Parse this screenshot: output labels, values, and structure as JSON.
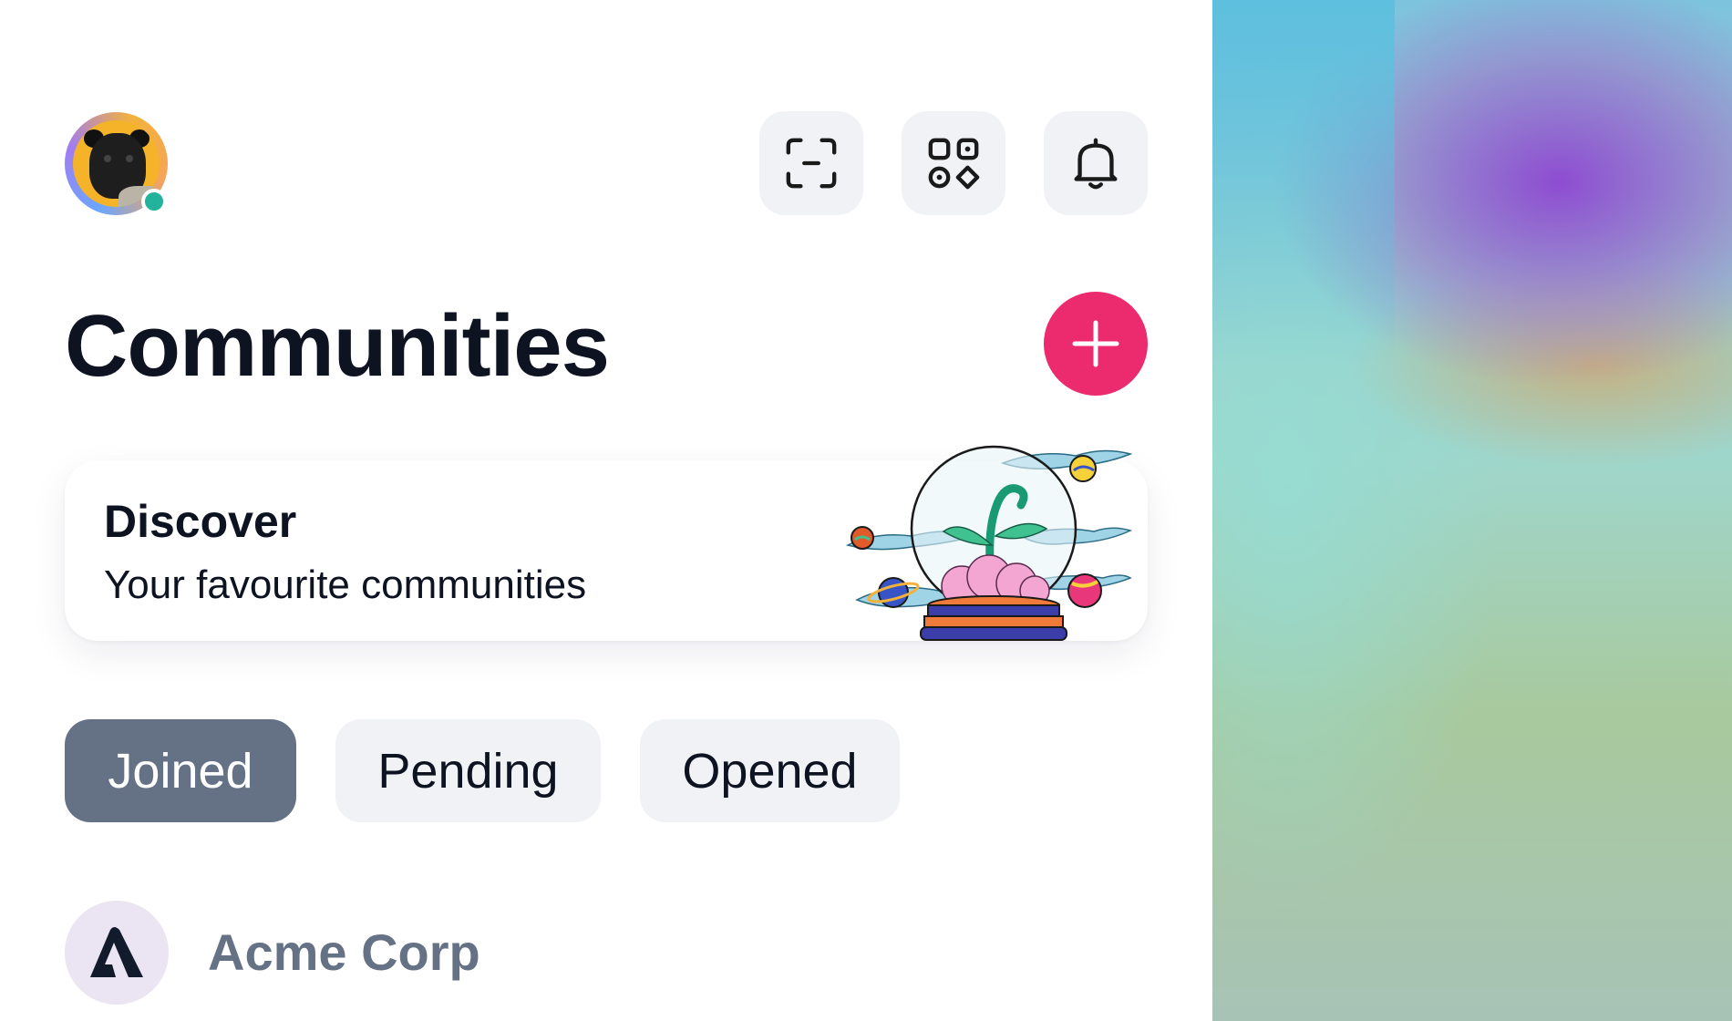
{
  "header": {
    "avatar_icon": "user-avatar-pug",
    "status_color": "#23b39c",
    "actions": [
      {
        "icon": "scan-icon",
        "label": "Scan"
      },
      {
        "icon": "apps-icon",
        "label": "Apps"
      },
      {
        "icon": "bell-icon",
        "label": "Notifications"
      }
    ]
  },
  "page": {
    "title": "Communities",
    "add_icon": "plus-icon",
    "accent": "#ec2b6f"
  },
  "discover": {
    "title": "Discover",
    "subtitle": "Your favourite communities",
    "illustration": "snow-globe-plant-illustration"
  },
  "tabs": [
    {
      "label": "Joined",
      "active": true
    },
    {
      "label": "Pending",
      "active": false
    },
    {
      "label": "Opened",
      "active": false
    }
  ],
  "communities": [
    {
      "name": "Acme Corp",
      "logo": "acme-logo-icon"
    }
  ]
}
